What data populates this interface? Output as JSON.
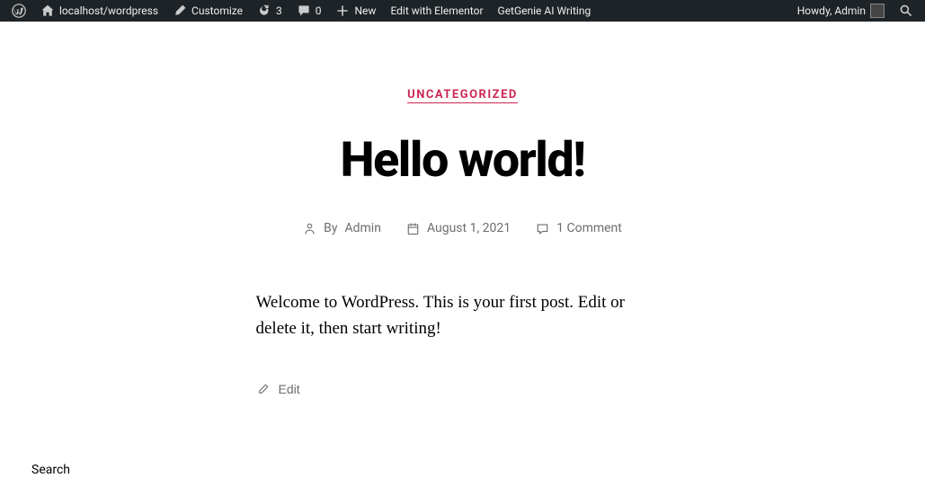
{
  "adminbar": {
    "site_name": "localhost/wordpress",
    "customize": "Customize",
    "updates_count": "3",
    "comments_count": "0",
    "new_label": "New",
    "elementor": "Edit with Elementor",
    "getgenie": "GetGenie AI Writing",
    "howdy": "Howdy, Admin"
  },
  "post": {
    "category": "UNCATEGORIZED",
    "title": "Hello world!",
    "by_prefix": "By ",
    "author": "Admin",
    "date": "August 1, 2021",
    "comments": "1 Comment",
    "content": "Welcome to WordPress. This is your first post. Edit or delete it, then start writing!",
    "edit_label": "Edit"
  },
  "footer": {
    "search_label": "Search"
  }
}
